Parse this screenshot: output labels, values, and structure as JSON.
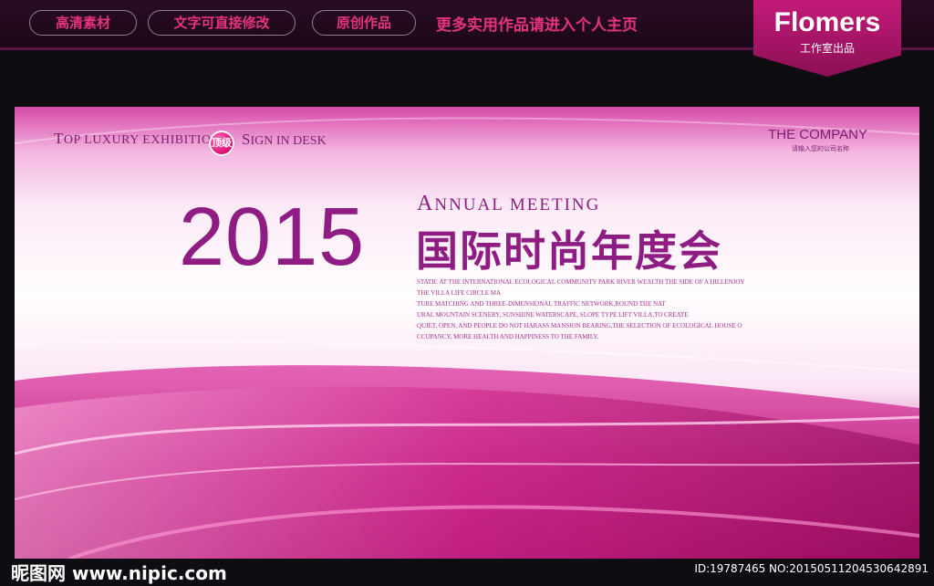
{
  "topbar": {
    "pills": [
      "高清素材",
      "文字可直接修改",
      "原创作品"
    ],
    "promo": "更多实用作品请进入个人主页"
  },
  "badge": {
    "brand": "Flomers",
    "sub": "工作室出品"
  },
  "poster": {
    "tagline_cap": "T",
    "tagline_rest": "OP LUXURY EXHIBITION",
    "seal": "顶级",
    "sign_cap": "S",
    "sign_rest": "IGN IN DESK",
    "company": "THE COMPANY",
    "company_sub": "请输入您的公司名称",
    "year": "2015",
    "annual_cap": "A",
    "annual_rest": "NNUAL MEETING",
    "cn_title": "国际时尚年度会",
    "paragraph": [
      "STATIC AT THE INTERNATIONAL ECOLOGICAL COMMUNITY PARK RIVER WEALTH THE SIDE OF A HILLENJOY",
      "THE VILLA LIFE CIRCLE MA",
      "TURE MATCHING AND THREE-DIMENSIONAL TRAFFIC NETWORK,ROUND THE NAT",
      "URAL MOUNTAIN SCENERY, SUNSHINE WATERSCAPE, SLOPE TYPE LIFT VILLA,TO CREATE",
      "QUIET, OPEN, AND PEOPLE DO NOT HARASS MANSION BEARING,THE SELECTION OF ECOLOGICAL HOUSE O",
      "CCUPANCY, MORE HEALTH AND HAPPINESS TO THE FAMILY."
    ],
    "colors": {
      "primary": "#8e1c82",
      "accent": "#e6337f"
    }
  },
  "footer": {
    "logo": "昵图网 www.nipic.com",
    "id": "ID:19787465 NO:20150511204530642891"
  }
}
